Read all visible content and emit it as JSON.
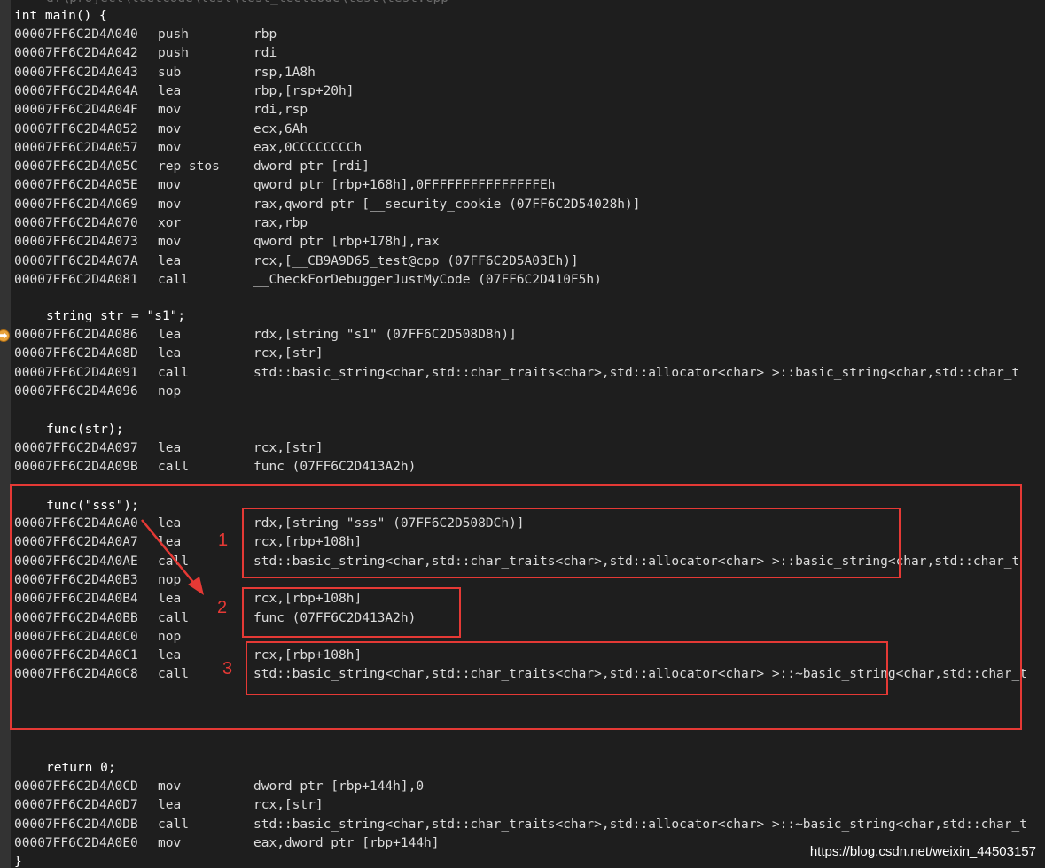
{
  "file_path": "d:\\project\\leetcode\\test\\test_leetcode\\test\\test.cpp",
  "source_lines": {
    "main_decl": "int main() {",
    "str_decl": "string str = \"s1\";",
    "func_str": "func(str);",
    "func_sss": "func(\"sss\");",
    "return_0": "return 0;",
    "close_brace": "}"
  },
  "disasm": {
    "prologue": [
      {
        "addr": "00007FF6C2D4A040",
        "mn": "push",
        "op": "rbp"
      },
      {
        "addr": "00007FF6C2D4A042",
        "mn": "push",
        "op": "rdi"
      },
      {
        "addr": "00007FF6C2D4A043",
        "mn": "sub",
        "op": "rsp,1A8h"
      },
      {
        "addr": "00007FF6C2D4A04A",
        "mn": "lea",
        "op": "rbp,[rsp+20h]"
      },
      {
        "addr": "00007FF6C2D4A04F",
        "mn": "mov",
        "op": "rdi,rsp"
      },
      {
        "addr": "00007FF6C2D4A052",
        "mn": "mov",
        "op": "ecx,6Ah"
      },
      {
        "addr": "00007FF6C2D4A057",
        "mn": "mov",
        "op": "eax,0CCCCCCCCh"
      },
      {
        "addr": "00007FF6C2D4A05C",
        "mn": "rep stos",
        "op": "dword ptr [rdi]"
      },
      {
        "addr": "00007FF6C2D4A05E",
        "mn": "mov",
        "op": "qword ptr [rbp+168h],0FFFFFFFFFFFFFFFEh"
      },
      {
        "addr": "00007FF6C2D4A069",
        "mn": "mov",
        "op": "rax,qword ptr [__security_cookie (07FF6C2D54028h)]"
      },
      {
        "addr": "00007FF6C2D4A070",
        "mn": "xor",
        "op": "rax,rbp"
      },
      {
        "addr": "00007FF6C2D4A073",
        "mn": "mov",
        "op": "qword ptr [rbp+178h],rax"
      },
      {
        "addr": "00007FF6C2D4A07A",
        "mn": "lea",
        "op": "rcx,[__CB9A9D65_test@cpp (07FF6C2D5A03Eh)]"
      },
      {
        "addr": "00007FF6C2D4A081",
        "mn": "call",
        "op": "__CheckForDebuggerJustMyCode (07FF6C2D410F5h)"
      }
    ],
    "str_block": [
      {
        "addr": "00007FF6C2D4A086",
        "mn": "lea",
        "op": "rdx,[string \"s1\" (07FF6C2D508D8h)]"
      },
      {
        "addr": "00007FF6C2D4A08D",
        "mn": "lea",
        "op": "rcx,[str]"
      },
      {
        "addr": "00007FF6C2D4A091",
        "mn": "call",
        "op": "std::basic_string<char,std::char_traits<char>,std::allocator<char> >::basic_string<char,std::char_t"
      },
      {
        "addr": "00007FF6C2D4A096",
        "mn": "nop",
        "op": ""
      }
    ],
    "func_str_block": [
      {
        "addr": "00007FF6C2D4A097",
        "mn": "lea",
        "op": "rcx,[str]"
      },
      {
        "addr": "00007FF6C2D4A09B",
        "mn": "call",
        "op": "func (07FF6C2D413A2h)"
      }
    ],
    "func_sss_block": [
      {
        "addr": "00007FF6C2D4A0A0",
        "mn": "lea",
        "op": "rdx,[string \"sss\" (07FF6C2D508DCh)]"
      },
      {
        "addr": "00007FF6C2D4A0A7",
        "mn": "lea",
        "op": "rcx,[rbp+108h]"
      },
      {
        "addr": "00007FF6C2D4A0AE",
        "mn": "call",
        "op": "std::basic_string<char,std::char_traits<char>,std::allocator<char> >::basic_string<char,std::char_t"
      },
      {
        "addr": "00007FF6C2D4A0B3",
        "mn": "nop",
        "op": ""
      },
      {
        "addr": "00007FF6C2D4A0B4",
        "mn": "lea",
        "op": "rcx,[rbp+108h]"
      },
      {
        "addr": "00007FF6C2D4A0BB",
        "mn": "call",
        "op": "func (07FF6C2D413A2h)"
      },
      {
        "addr": "00007FF6C2D4A0C0",
        "mn": "nop",
        "op": ""
      },
      {
        "addr": "00007FF6C2D4A0C1",
        "mn": "lea",
        "op": "rcx,[rbp+108h]"
      },
      {
        "addr": "00007FF6C2D4A0C8",
        "mn": "call",
        "op": "std::basic_string<char,std::char_traits<char>,std::allocator<char> >::~basic_string<char,std::char_t"
      }
    ],
    "return_block": [
      {
        "addr": "00007FF6C2D4A0CD",
        "mn": "mov",
        "op": "dword ptr [rbp+144h],0"
      },
      {
        "addr": "00007FF6C2D4A0D7",
        "mn": "lea",
        "op": "rcx,[str]"
      },
      {
        "addr": "00007FF6C2D4A0DB",
        "mn": "call",
        "op": "std::basic_string<char,std::char_traits<char>,std::allocator<char> >::~basic_string<char,std::char_t"
      },
      {
        "addr": "00007FF6C2D4A0E0",
        "mn": "mov",
        "op": "eax,dword ptr [rbp+144h]"
      }
    ]
  },
  "annotations": {
    "label_1": "1",
    "label_2": "2",
    "label_3": "3"
  },
  "watermark": "https://blog.csdn.net/weixin_44503157",
  "colors": {
    "background": "#1e1e1e",
    "text": "#dcdcdc",
    "annotation": "#e53935",
    "breakpoint": "#e8a33c"
  },
  "icons": {
    "current_instruction": "instruction-pointer-arrow-icon"
  }
}
